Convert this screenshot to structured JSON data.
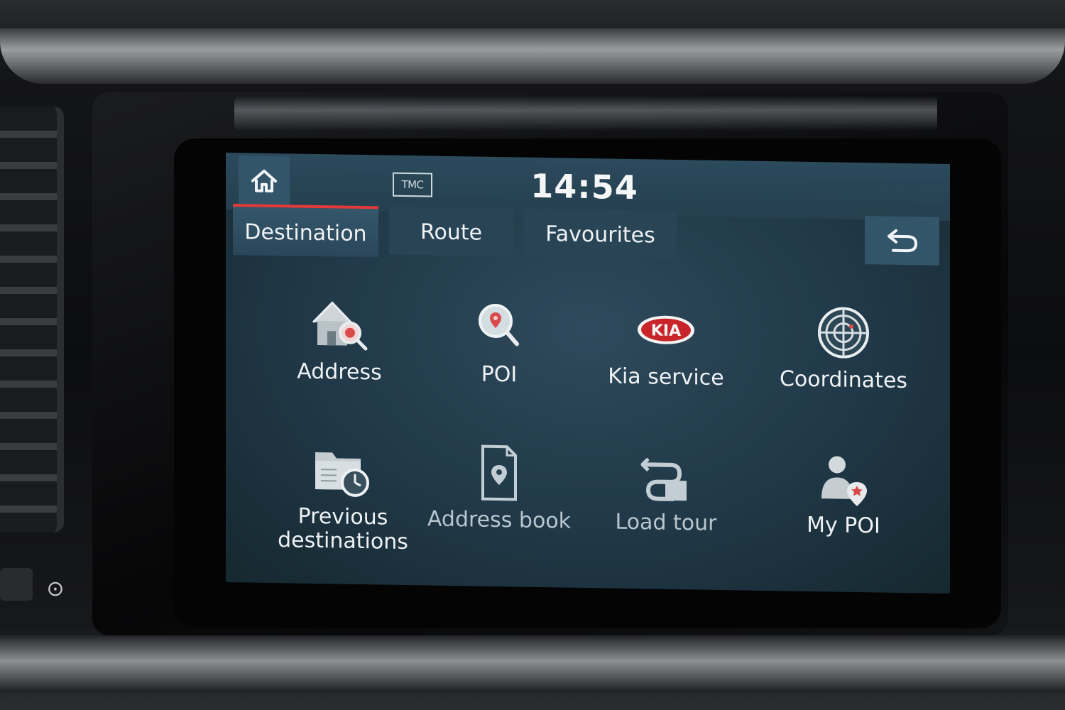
{
  "header": {
    "home_icon": "home-icon",
    "tmc_label": "TMC",
    "clock": "14:54"
  },
  "tabs": [
    {
      "label": "Destination",
      "active": true
    },
    {
      "label": "Route",
      "active": false
    },
    {
      "label": "Favourites",
      "active": false
    }
  ],
  "back_icon": "back-arrow-icon",
  "menu": [
    {
      "label": "Address",
      "icon": "house-search-icon",
      "enabled": true
    },
    {
      "label": "POI",
      "icon": "poi-search-icon",
      "enabled": true
    },
    {
      "label": "Kia service",
      "icon": "kia-logo-icon",
      "enabled": true
    },
    {
      "label": "Coordinates",
      "icon": "radar-target-icon",
      "enabled": true
    },
    {
      "label": "Previous destinations",
      "icon": "folder-clock-icon",
      "enabled": true
    },
    {
      "label": "Address book",
      "icon": "address-book-icon",
      "enabled": false
    },
    {
      "label": "Load tour",
      "icon": "load-tour-icon",
      "enabled": false
    },
    {
      "label": "My POI",
      "icon": "user-pin-icon",
      "enabled": true
    }
  ],
  "kia_logo_text": "KIA",
  "colors": {
    "accent": "#e53a3a",
    "screen_bg": "#203847",
    "text": "#eef2f4"
  }
}
